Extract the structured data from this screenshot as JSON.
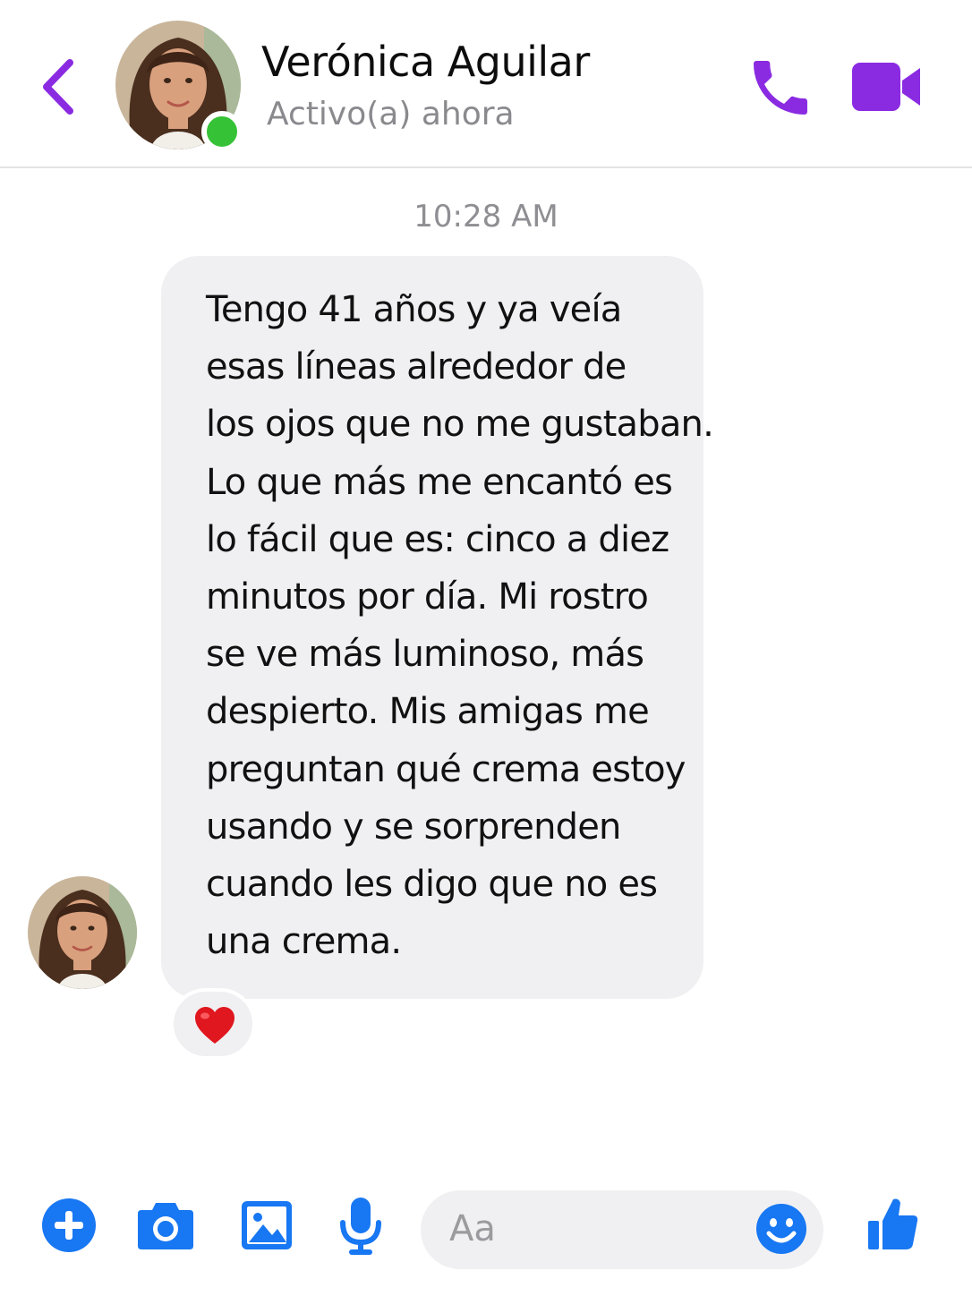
{
  "header": {
    "contact_name": "Verónica Aguilar",
    "status": "Activo(a) ahora",
    "back_icon": "chevron-left-icon",
    "call_icon": "phone-icon",
    "video_icon": "video-camera-icon"
  },
  "conversation": {
    "timestamp": "10:28 AM",
    "message_lines": [
      "Tengo 41 años y ya veía",
      "esas líneas alrededor de",
      "los ojos que no me gustaban.",
      "Lo que más me encantó es",
      "lo fácil que es: cinco a diez",
      "minutos por día. Mi rostro",
      "se ve más luminoso, más",
      "despierto. Mis amigas me",
      "preguntan qué crema estoy",
      "usando y se sorprenden",
      "cuando les digo que no es",
      "una crema."
    ],
    "reaction": "heart-icon"
  },
  "composer": {
    "placeholder": "Aa",
    "tools": [
      "plus-icon",
      "camera-icon",
      "image-icon",
      "microphone-icon"
    ],
    "emoji_icon": "smiley-icon",
    "like_icon": "thumbs-up-icon"
  },
  "colors": {
    "accent_purple": "#8a2be2",
    "accent_blue": "#1877f2",
    "online_green": "#36c236",
    "bubble_gray": "#f0f0f2"
  }
}
